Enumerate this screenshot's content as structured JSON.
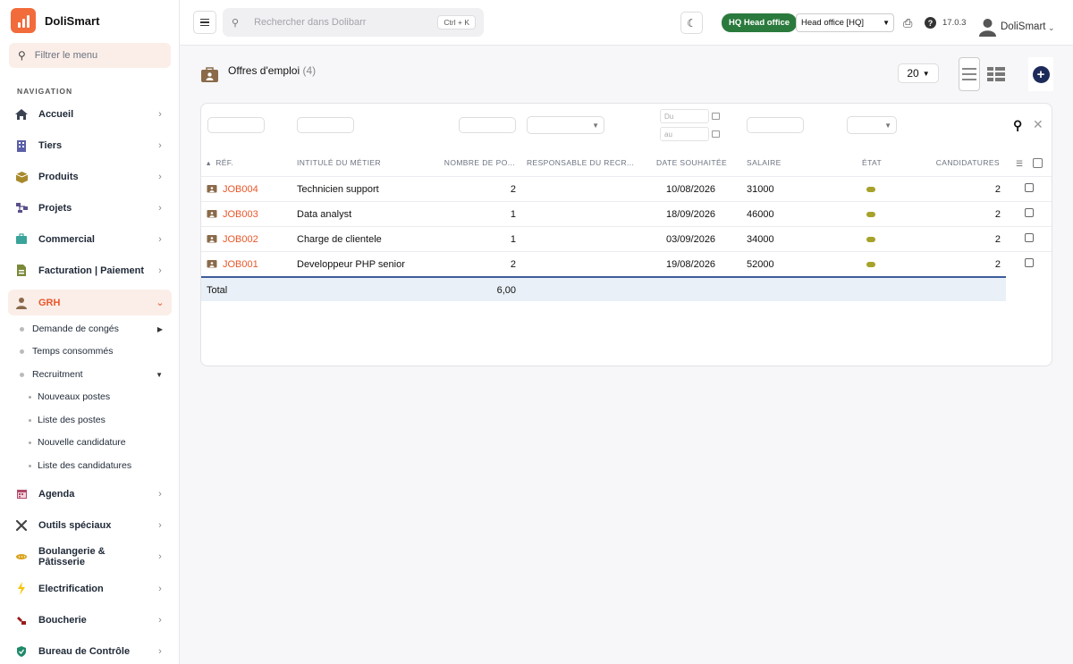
{
  "app": {
    "name": "DoliSmart",
    "menu_filter_placeholder": "Filtrer le menu",
    "nav_title": "NAVIGATION"
  },
  "sidebar": {
    "items": [
      {
        "label": "Accueil",
        "icon": "home-icon"
      },
      {
        "label": "Tiers",
        "icon": "building-icon"
      },
      {
        "label": "Produits",
        "icon": "box-icon"
      },
      {
        "label": "Projets",
        "icon": "project-icon"
      },
      {
        "label": "Commercial",
        "icon": "briefcase-icon"
      },
      {
        "label": "Facturation | Paiement",
        "icon": "invoice-icon"
      },
      {
        "label": "GRH",
        "icon": "user-tie-icon"
      },
      {
        "label": "Agenda",
        "icon": "calendar-icon"
      },
      {
        "label": "Outils spéciaux",
        "icon": "tools-icon"
      },
      {
        "label": "Boulangerie & Pâtisserie",
        "icon": "bread-icon"
      },
      {
        "label": "Electrification",
        "icon": "bolt-icon"
      },
      {
        "label": "Boucherie",
        "icon": "meat-icon"
      },
      {
        "label": "Bureau de Contrôle",
        "icon": "shield-icon"
      }
    ],
    "grh_sub": [
      {
        "label": "Demande de congés"
      },
      {
        "label": "Temps consommés"
      },
      {
        "label": "Recruitment"
      }
    ],
    "recruitment_sub": [
      {
        "label": "Nouveaux postes"
      },
      {
        "label": "Liste des postes"
      },
      {
        "label": "Nouvelle candidature"
      },
      {
        "label": "Liste des candidatures"
      }
    ]
  },
  "topbar": {
    "search_placeholder": "Rechercher dans Dolibarr",
    "search_shortcut": "Ctrl + K",
    "entity_badge": "HQ Head office",
    "entity_select": "Head office [HQ]",
    "version": "17.0.3",
    "user_name": "DoliSmart"
  },
  "page": {
    "title": "Offres d'emploi",
    "count": "(4)",
    "limit": "20"
  },
  "filters": {
    "date_from_placeholder": "Du",
    "date_to_placeholder": "au"
  },
  "table": {
    "headers": {
      "ref": "RÉF.",
      "label": "INTITULÉ DU MÉTIER",
      "qty": "NOMBRE DE PO...",
      "responsible": "RESPONSABLE DU RECR...",
      "date": "DATE SOUHAITÉE",
      "salary": "SALAIRE",
      "status": "ÉTAT",
      "applications": "CANDIDATURES"
    },
    "rows": [
      {
        "ref": "JOB004",
        "label": "Technicien support",
        "qty": "2",
        "responsible": "",
        "date": "10/08/2026",
        "salary": "31000",
        "applications": "2"
      },
      {
        "ref": "JOB003",
        "label": "Data analyst",
        "qty": "1",
        "responsible": "",
        "date": "18/09/2026",
        "salary": "46000",
        "applications": "2"
      },
      {
        "ref": "JOB002",
        "label": "Charge de clientele",
        "qty": "1",
        "responsible": "",
        "date": "03/09/2026",
        "salary": "34000",
        "applications": "2"
      },
      {
        "ref": "JOB001",
        "label": "Developpeur PHP senior",
        "qty": "2",
        "responsible": "",
        "date": "19/08/2026",
        "salary": "52000",
        "applications": "2"
      }
    ],
    "total_label": "Total",
    "total_qty": "6,00"
  },
  "colors": {
    "accent": "#e8572a",
    "status_draft": "#a6a22a",
    "entity_badge": "#2b7a3d",
    "new_button": "#1c2b59"
  }
}
